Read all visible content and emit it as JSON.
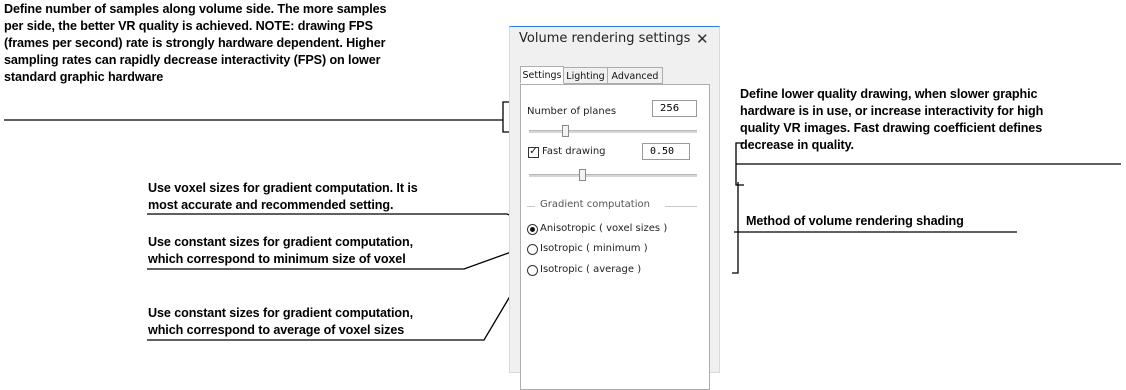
{
  "annotations": {
    "samples": [
      "Define number of samples along volume side. The more samples",
      "per side, the better VR quality is achieved. NOTE: drawing FPS",
      "(frames per second) rate is strongly hardware dependent. Higher",
      "sampling rates can rapidly decrease interactivity (FPS) on lower",
      "standard graphic hardware"
    ],
    "fast_drawing": [
      "Define lower quality drawing, when slower graphic",
      "hardware is in use, or increase interactivity for high",
      "quality VR images. Fast drawing coefficient defines",
      "decrease in quality."
    ],
    "anisotropic": [
      "Use voxel sizes for gradient computation. It is",
      "most accurate and recommended setting."
    ],
    "isotropic_min": [
      "Use constant sizes for gradient computation,",
      "which correspond to minimum size of voxel"
    ],
    "isotropic_avg": [
      "Use constant sizes for gradient computation,",
      "which correspond to average of voxel sizes"
    ],
    "shading": "Method of volume rendering shading"
  },
  "panel": {
    "title": "Volume rendering settings",
    "close_glyph": "✕",
    "tabs": [
      {
        "label": "Settings",
        "active": true
      },
      {
        "label": "Lighting",
        "active": false
      },
      {
        "label": "Advanced",
        "active": false
      }
    ],
    "number_of_planes": {
      "label": "Number of planes",
      "value": "256"
    },
    "fast_drawing": {
      "label": "Fast drawing",
      "checked": true,
      "check_glyph": "✓",
      "value": "0.50"
    },
    "gradient_group": {
      "title": "Gradient computation",
      "options": [
        {
          "label": "Anisotropic ( voxel sizes )",
          "selected": true
        },
        {
          "label": "Isotropic ( minimum )",
          "selected": false
        },
        {
          "label": "Isotropic ( average )",
          "selected": false
        }
      ]
    }
  }
}
